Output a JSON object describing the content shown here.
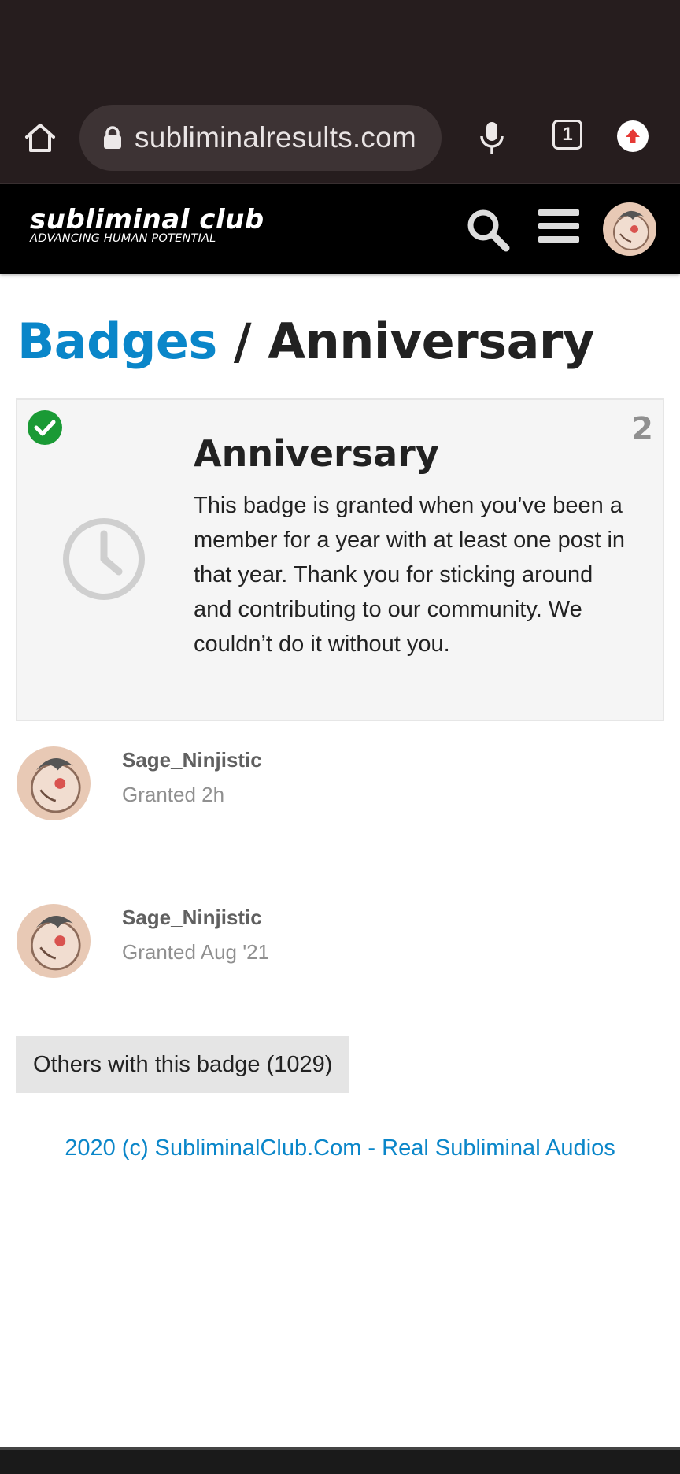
{
  "browser": {
    "url": "subliminalresults.com",
    "tab_count": "1"
  },
  "site": {
    "logo_title": "subliminal club",
    "logo_tagline": "ADVANCING HUMAN POTENTIAL"
  },
  "breadcrumb": {
    "parent": "Badges",
    "separator": " / ",
    "current": "Anniversary"
  },
  "badge": {
    "name": "Anniversary",
    "count": "2",
    "description": "This badge is granted when you’ve been a member for a year with at least one post in that year. Thank you for sticking around and contributing to our community. We couldn’t do it without you.",
    "icon": "clock-icon",
    "granted_icon": "check-circle-icon"
  },
  "grants": [
    {
      "user": "Sage_Ninjistic",
      "time": "Granted 2h"
    },
    {
      "user": "Sage_Ninjistic",
      "time": "Granted Aug '21"
    }
  ],
  "others_button": "Others with this badge (1029)",
  "footer": "2020 (c) SubliminalClub.Com - Real Subliminal Audios",
  "colors": {
    "accent": "#0a86c9",
    "browser_bg": "#261d1e",
    "header_bg": "#000000",
    "success": "#1a9a35"
  }
}
